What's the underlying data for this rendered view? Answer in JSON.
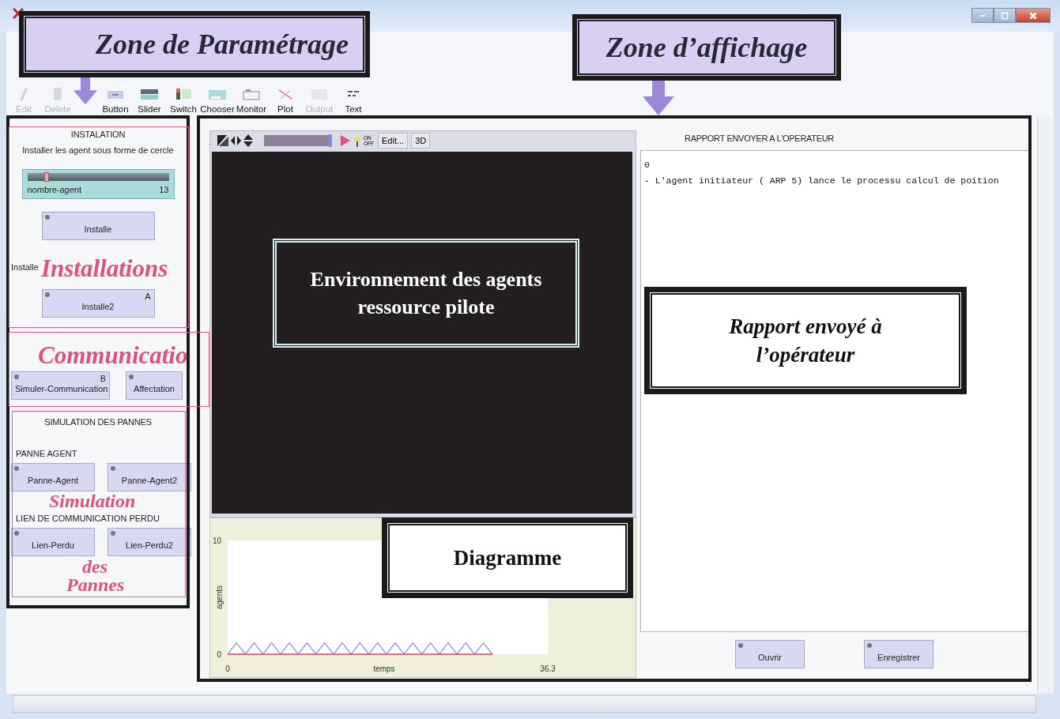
{
  "toolbar": [
    {
      "kind": "edit",
      "label": "Edit",
      "disabled": true
    },
    {
      "kind": "delete",
      "label": "Delete",
      "disabled": true
    },
    {
      "kind": "button",
      "label": "Button",
      "disabled": false
    },
    {
      "kind": "slider",
      "label": "Slider",
      "disabled": false
    },
    {
      "kind": "switch",
      "label": "Switch",
      "disabled": false
    },
    {
      "kind": "chooser",
      "label": "Chooser",
      "disabled": false
    },
    {
      "kind": "monitor",
      "label": "Monitor",
      "disabled": false
    },
    {
      "kind": "plot",
      "label": "Plot",
      "disabled": false
    },
    {
      "kind": "output",
      "label": "Output",
      "disabled": true
    },
    {
      "kind": "text",
      "label": "Text",
      "disabled": false
    }
  ],
  "left_panel": {
    "heading": "INSTALATION",
    "description": "Installer les agent sous forme de cercle",
    "slider": {
      "name": "nombre-agent",
      "value": "13",
      "level": 0.12
    },
    "install_button": {
      "label": "Installe"
    },
    "note": "Installe",
    "install2_button": {
      "label": "Installe2",
      "key": "A"
    },
    "comm_buttons": [
      {
        "label": "Simuler-Communication",
        "key": "B"
      },
      {
        "label": "Affectation"
      }
    ],
    "failures_heading": "SIMULATION DES PANNES",
    "agent_heading": "PANNE AGENT",
    "agent_buttons": [
      {
        "label": "Panne-Agent"
      },
      {
        "label": "Panne-Agent2"
      }
    ],
    "link_heading": "LIEN DE COMMUNICATION PERDU",
    "link_buttons": [
      {
        "label": "Lien-Perdu"
      },
      {
        "label": "Lien-Perdu2"
      }
    ]
  },
  "view": {
    "speed": {
      "level": 0.95
    },
    "updates_label": "ON OFF",
    "edit_button": "Edit...",
    "three_d_button": "3D"
  },
  "plot": {
    "chart_data": {
      "type": "line",
      "xlabel": "temps",
      "ylabel": "agents",
      "x": [
        0,
        1,
        2,
        3,
        4,
        5,
        6,
        7,
        8,
        9,
        10,
        11,
        12,
        13,
        14,
        15,
        16,
        17,
        18,
        19,
        20,
        21,
        22,
        23,
        24,
        25,
        26,
        27,
        28,
        29,
        30
      ],
      "series": [
        {
          "color": "#9a8fd8",
          "values": [
            0,
            1,
            0,
            1,
            0,
            1,
            0,
            1,
            0,
            1,
            0,
            1,
            0,
            1,
            0,
            1,
            0,
            1,
            0,
            1,
            0,
            1,
            0,
            1,
            0,
            1,
            0,
            1,
            0,
            1,
            0
          ]
        },
        {
          "color": "#e0405a",
          "values": [
            0,
            0,
            0,
            0,
            0,
            0,
            0,
            0,
            0,
            0,
            0,
            0,
            0,
            0,
            0,
            0,
            0,
            0,
            0,
            0,
            0,
            0,
            0,
            0,
            0,
            0,
            0,
            0,
            0,
            0,
            0
          ]
        }
      ],
      "xlim": [
        0,
        36.3
      ],
      "ylim": [
        0,
        10
      ],
      "xticks": [
        0,
        36.3
      ],
      "yticks": [
        0,
        10
      ]
    }
  },
  "report": {
    "title": "RAPPORT ENVOYER A L'OPERATEUR",
    "lines": [
      "0",
      "- L'agent initiateur ( ARP 5) lance le processu calcul de poition"
    ],
    "buttons": [
      {
        "label": "Ouvrir"
      },
      {
        "label": "Enregistrer"
      }
    ]
  },
  "zone_titles": [
    "Zone de Paramétrage",
    "Zone d’affichage"
  ],
  "callouts": [
    {
      "kind": "dark",
      "text": "Environnement des agents ressource pilote"
    },
    {
      "kind": "light",
      "text": "Diagramme"
    },
    {
      "kind": "light_italic",
      "text": "Rapport  envoyé à l’opérateur"
    }
  ],
  "region_labels": [
    "Installations",
    "Communicatio",
    "Simulation",
    "des",
    "Pannes"
  ]
}
